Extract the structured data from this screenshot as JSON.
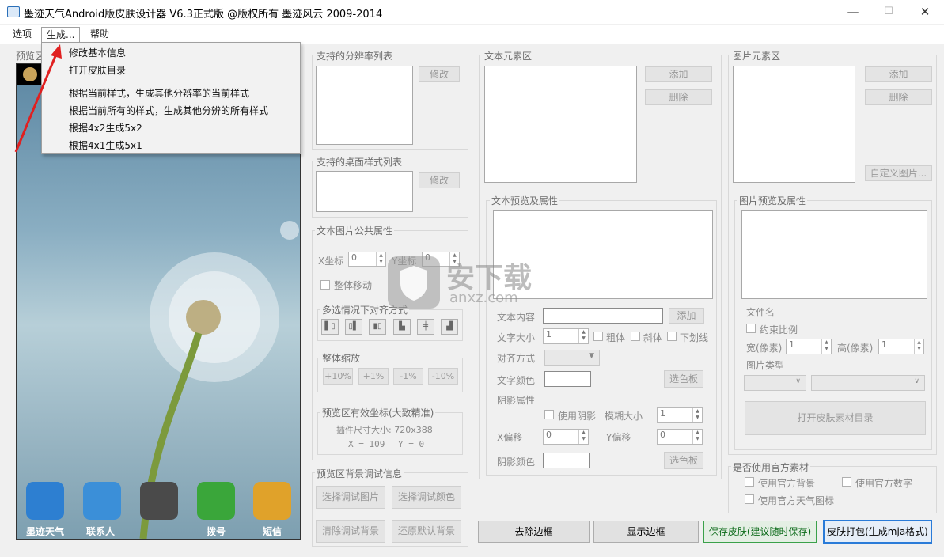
{
  "window": {
    "title": "墨迹天气Android版皮肤设计器 V6.3正式版 @版权所有 墨迹风云 2009-2014",
    "minimize": "—",
    "maximize": "☐",
    "close": "✕"
  },
  "menubar": {
    "options": "选项",
    "generate": "生成...",
    "help": "帮助"
  },
  "generate_menu": {
    "items": [
      "修改基本信息",
      "打开皮肤目录",
      "根据当前样式，生成其他分辨率的当前样式",
      "根据当前所有的样式，生成其他分辨的所有样式",
      "根据4x2生成5x2",
      "根据4x1生成5x1"
    ]
  },
  "preview": {
    "label": "预览区",
    "dock": [
      {
        "label": "墨迹天气",
        "color": "#2d7fd1"
      },
      {
        "label": "联系人",
        "color": "#3b8fd8"
      },
      {
        "label": "",
        "color": "#4a4a4a"
      },
      {
        "label": "拨号",
        "color": "#3aa63a"
      },
      {
        "label": "短信",
        "color": "#e0a22a"
      }
    ]
  },
  "resolution_group": {
    "label": "支持的分辨率列表",
    "edit": "修改"
  },
  "desktop_group": {
    "label": "支持的桌面样式列表",
    "edit": "修改"
  },
  "common_group": {
    "label": "文本图片公共属性",
    "x_label": "X坐标",
    "x_value": "0",
    "y_label": "Y坐标",
    "y_value": "0",
    "move_all": "整体移动",
    "align_label": "多选情况下对齐方式",
    "zoom_label": "整体缩放",
    "zoom_buttons": [
      "+10%",
      "+1%",
      "-1%",
      "-10%"
    ],
    "coords_label": "预览区有效坐标(大致精准)",
    "size_text": "插件尺寸大小: 720x388",
    "x_readout": "X = 109",
    "y_readout": "Y = 0"
  },
  "bg_group": {
    "label": "预览区背景调试信息",
    "select_image": "选择调试图片",
    "select_color": "选择调试颜色",
    "clear_bg": "清除调试背景",
    "restore_bg": "还原默认背景"
  },
  "text_group": {
    "label": "文本元素区",
    "add": "添加",
    "delete": "删除"
  },
  "text_props": {
    "label": "文本预览及属性",
    "content": "文本内容",
    "add": "添加",
    "size": "文字大小",
    "size_value": "1",
    "bold": "粗体",
    "italic": "斜体",
    "underline": "下划线",
    "align": "对齐方式",
    "color": "文字颜色",
    "palette": "选色板",
    "shadow": "阴影属性",
    "use_shadow": "使用阴影",
    "blur": "模糊大小",
    "blur_value": "1",
    "x_offset": "X偏移",
    "x_offset_value": "0",
    "y_offset": "Y偏移",
    "y_offset_value": "0",
    "shadow_color": "阴影颜色",
    "palette2": "选色板"
  },
  "image_group": {
    "label": "图片元素区",
    "add": "添加",
    "delete": "删除",
    "custom": "自定义图片..."
  },
  "image_props": {
    "label": "图片预览及属性",
    "filename": "文件名",
    "ratio": "约束比例",
    "width": "宽(像素)",
    "width_value": "1",
    "height": "高(像素)",
    "height_value": "1",
    "type": "图片类型",
    "open_dir": "打开皮肤素材目录"
  },
  "official_group": {
    "label": "是否使用官方素材",
    "bg": "使用官方背景",
    "digits": "使用官方数字",
    "icons": "使用官方天气图标"
  },
  "bottom": {
    "remove_border": "去除边框",
    "show_border": "显示边框",
    "save": "保存皮肤(建议随时保存)",
    "pack": "皮肤打包(生成mja格式)"
  },
  "watermark": {
    "brand": "安下载",
    "site": "anxz.com"
  }
}
